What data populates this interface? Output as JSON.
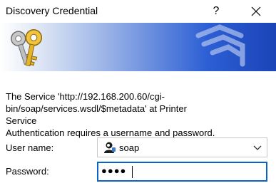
{
  "window": {
    "title": "Discovery Credential",
    "help_glyph": "?",
    "close_icon": "close-icon"
  },
  "banner": {
    "icon": "keys-icon",
    "colors": {
      "start": "#ffffff",
      "end": "#1a44b8"
    }
  },
  "message": {
    "line1": "The Service 'http://192.168.200.60/cgi-",
    "line2": "bin/soap/services.wsdl/$metadata' at Printer Service",
    "line3": "Authentication requires a username and password."
  },
  "form": {
    "username": {
      "label": "User name:",
      "value": "soap",
      "icon": "user-icon"
    },
    "password": {
      "label": "Password:",
      "value": "●●●●"
    }
  },
  "colors": {
    "focus_border": "#0a64c8",
    "field_border": "#c8c8c8"
  }
}
